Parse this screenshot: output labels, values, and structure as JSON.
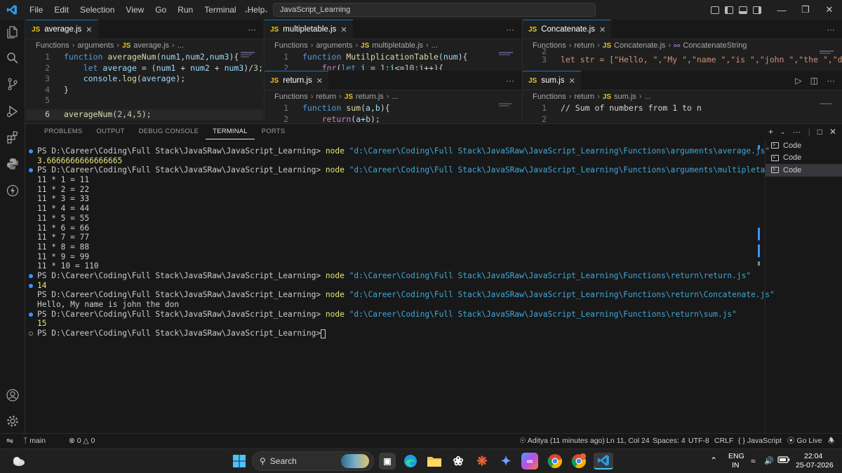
{
  "titlebar": {
    "menu": [
      "File",
      "Edit",
      "Selection",
      "View",
      "Go",
      "Run",
      "Terminal",
      "Help"
    ],
    "search_text": "JavaScript_Learning"
  },
  "editors": {
    "average": {
      "tab": "average.js",
      "breadcrumb": [
        "Functions",
        "arguments",
        "average.js",
        "..."
      ],
      "lines": [
        {
          "n": "1",
          "t": "function averageNum(num1,num2,num3){"
        },
        {
          "n": "2",
          "t": "    let average = (num1 + num2 + num3)/3;"
        },
        {
          "n": "3",
          "t": "    console.log(average);"
        },
        {
          "n": "4",
          "t": "}"
        },
        {
          "n": "5",
          "t": ""
        },
        {
          "n": "6",
          "t": "averageNum(2,4,5);"
        }
      ]
    },
    "multipletable": {
      "tab": "multipletable.js",
      "breadcrumb": [
        "Functions",
        "arguments",
        "multipletable.js",
        "..."
      ],
      "lines": [
        {
          "n": "1",
          "t": "function MutilplicationTable(num){"
        },
        {
          "n": "2",
          "t": "    for(let i = 1;i<=10;i++){"
        }
      ]
    },
    "concatenate": {
      "tab": "Concatenate.js",
      "breadcrumb": [
        "Functions",
        "return",
        "Concatenate.js",
        "ConcatenateString"
      ],
      "lines": [
        {
          "n": "2",
          "t": ""
        },
        {
          "n": "3",
          "t": "let str = [\"Hello, \",\"My \",\"name \",\"is \",\"john \",\"the \",\"do"
        }
      ]
    },
    "return": {
      "tab": "return.js",
      "breadcrumb": [
        "Functions",
        "return",
        "return.js",
        "..."
      ],
      "lines": [
        {
          "n": "1",
          "t": "function sum(a,b){"
        },
        {
          "n": "2",
          "t": "    return(a+b);"
        }
      ]
    },
    "sum": {
      "tab": "sum.js",
      "breadcrumb": [
        "Functions",
        "return",
        "sum.js",
        "..."
      ],
      "lines": [
        {
          "n": "1",
          "t": "// Sum of numbers from 1 to n"
        },
        {
          "n": "2",
          "t": ""
        }
      ]
    }
  },
  "panel": {
    "tabs": [
      "PROBLEMS",
      "OUTPUT",
      "DEBUG CONSOLE",
      "TERMINAL",
      "PORTS"
    ],
    "active_tab": "TERMINAL",
    "terminals": [
      "Code",
      "Code",
      "Code"
    ],
    "prompt": "PS D:\\Career\\Coding\\Full Stack\\JavaSRaw\\JavaScript_Learning>",
    "node": "node",
    "cmd1_path": "\"d:\\Career\\Coding\\Full Stack\\JavaSRaw\\JavaScript_Learning\\Functions\\arguments\\average.js\"",
    "out1": "3.6666666666666665",
    "cmd2_path": "\"d:\\Career\\Coding\\Full Stack\\JavaSRaw\\JavaScript_Learning\\Functions\\arguments\\multipletable.js\"",
    "table": [
      "11 * 1 = 11",
      "11 * 2 = 22",
      "11 * 3 = 33",
      "11 * 4 = 44",
      "11 * 5 = 55",
      "11 * 6 = 66",
      "11 * 7 = 77",
      "11 * 8 = 88",
      "11 * 9 = 99",
      "11 * 10 = 110"
    ],
    "cmd3_path": "\"d:\\Career\\Coding\\Full Stack\\JavaSRaw\\JavaScript_Learning\\Functions\\return\\return.js\"",
    "out3": "14",
    "cmd4_path": "\"d:\\Career\\Coding\\Full Stack\\JavaSRaw\\JavaScript_Learning\\Functions\\return\\Concatenate.js\"",
    "out4": "Hello, My name is john the don",
    "cmd5_path": "\"d:\\Career\\Coding\\Full Stack\\JavaSRaw\\JavaScript_Learning\\Functions\\return\\sum.js\"",
    "out5": "15"
  },
  "statusbar": {
    "branch": "main",
    "errors": "0",
    "warnings": "0",
    "blame": "Aditya (11 minutes ago)",
    "position": "Ln 11, Col 24",
    "spaces": "Spaces: 4",
    "encoding": "UTF-8",
    "eol": "CRLF",
    "language": "JavaScript",
    "golive": "Go Live"
  },
  "taskbar": {
    "search": "Search",
    "lang_top": "ENG",
    "lang_bottom": "IN",
    "time": "22:04",
    "date": "25-07-2026"
  },
  "colors": {
    "accent": "#0078d4",
    "js_badge": "#e8c52a",
    "terminal_path": "#3fa8d8",
    "terminal_node": "#e5e57a"
  }
}
